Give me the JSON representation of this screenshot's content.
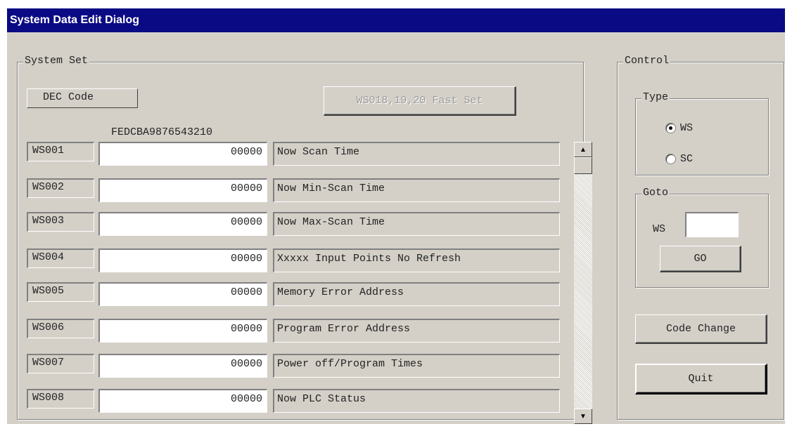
{
  "window": {
    "title": "System Data  Edit Dialog"
  },
  "system_set": {
    "legend": "System Set",
    "dec_code_label": "DEC Code",
    "fast_set_button": "WS018,19,20 Fast Set",
    "bit_header": "FEDCBA9876543210",
    "rows": [
      {
        "reg": "WS001",
        "value": "00000",
        "desc": "Now Scan Time"
      },
      {
        "reg": "WS002",
        "value": "00000",
        "desc": "Now Min-Scan Time"
      },
      {
        "reg": "WS003",
        "value": "00000",
        "desc": "Now Max-Scan Time"
      },
      {
        "reg": "WS004",
        "value": "00000",
        "desc": "Xxxxx Input Points No Refresh"
      },
      {
        "reg": "WS005",
        "value": "00000",
        "desc": "Memory Error Address"
      },
      {
        "reg": "WS006",
        "value": "00000",
        "desc": "Program Error Address"
      },
      {
        "reg": "WS007",
        "value": "00000",
        "desc": "Power off/Program Times"
      },
      {
        "reg": "WS008",
        "value": "00000",
        "desc": "Now PLC Status"
      }
    ]
  },
  "control": {
    "legend": "Control",
    "type": {
      "legend": "Type",
      "options": [
        {
          "label": "WS",
          "selected": true
        },
        {
          "label": "SC",
          "selected": false
        }
      ]
    },
    "goto": {
      "legend": "Goto",
      "field_label": "WS",
      "value": "",
      "go_button": "GO"
    },
    "code_change_button": "Code Change",
    "quit_button": "Quit"
  }
}
